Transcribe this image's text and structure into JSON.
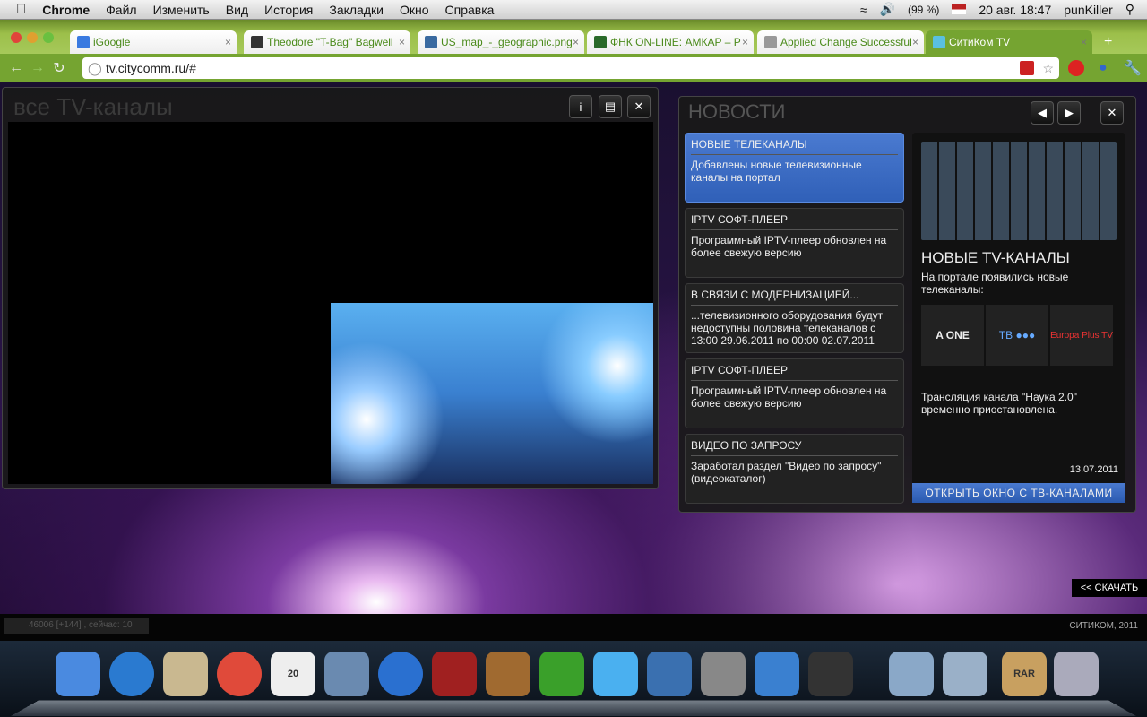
{
  "menubar": {
    "app": "Chrome",
    "items": [
      "Файл",
      "Изменить",
      "Вид",
      "История",
      "Закладки",
      "Окно",
      "Справка"
    ],
    "battery": "(99 %)",
    "datetime": "20 авг.  18:47",
    "user": "punKiller"
  },
  "tabs": [
    {
      "title": "iGoogle",
      "color": "#3a7ae0"
    },
    {
      "title": "Theodore \"T-Bag\" Bagwell",
      "color": "#333"
    },
    {
      "title": "US_map_-_geographic.png",
      "color": "#3a6aa0"
    },
    {
      "title": "ФНК ON-LINE: АМКАР – Р",
      "color": "#2a6a2a"
    },
    {
      "title": "Applied Change Successful",
      "color": "#999"
    },
    {
      "title": "СитиКом TV",
      "color": "#5ac0e0"
    }
  ],
  "url": "tv.citycomm.ru/#",
  "left_panel": {
    "title": "все TV-каналы"
  },
  "news_panel": {
    "title": "НОВОСТИ",
    "items": [
      {
        "title": "НОВЫЕ ТЕЛЕКАНАЛЫ",
        "text": "Добавлены новые телевизионные каналы на портал"
      },
      {
        "title": "IPTV СОФТ-ПЛЕЕР",
        "text": "Программный IPTV-плеер обновлен на более свежую версию"
      },
      {
        "title": "В СВЯЗИ С МОДЕРНИЗАЦИЕЙ...",
        "text": "...телевизионного оборудования будут недоступны половина телеканалов с 13:00 29.06.2011 по 00:00 02.07.2011"
      },
      {
        "title": "IPTV СОФТ-ПЛЕЕР",
        "text": "Программный IPTV-плеер обновлен на более свежую версию"
      },
      {
        "title": "ВИДЕО ПО ЗАПРОСУ",
        "text": "Заработал раздел \"Видео по запросу\" (видеокаталог)"
      }
    ],
    "feature": {
      "title": "НОВЫЕ TV-КАНАЛЫ",
      "text": "На портале появились новые телеканалы:",
      "logos": [
        "A ONE",
        "ТВ ●●●",
        "Europa Plus TV"
      ],
      "note": "Трансляция канала \"Наука 2.0\" временно приостановлена.",
      "date": "13.07.2011",
      "button": "ОТКРЫТЬ ОКНО С ТВ-КАНАЛАМИ"
    }
  },
  "download": "<< СКАЧАТЬ",
  "counter": "46006 [+144] , сейчас: 10",
  "copyright": "СИТИКОМ, 2011",
  "dock": [
    {
      "name": "finder",
      "color": "#4a8ae0"
    },
    {
      "name": "app-store",
      "color": "#2a7ad0"
    },
    {
      "name": "mail",
      "color": "#c9b890"
    },
    {
      "name": "chrome",
      "color": "#e04a3a"
    },
    {
      "name": "ical",
      "color": "#eee",
      "label": "20"
    },
    {
      "name": "iphoto",
      "color": "#6a8ab0"
    },
    {
      "name": "itunes",
      "color": "#2a70d0"
    },
    {
      "name": "front-row",
      "color": "#a02020"
    },
    {
      "name": "image-capture",
      "color": "#a06a30"
    },
    {
      "name": "adium",
      "color": "#3aa02a"
    },
    {
      "name": "icloud",
      "color": "#4ab0f0"
    },
    {
      "name": "parallels",
      "color": "#3a70b0"
    },
    {
      "name": "system-preferences",
      "color": "#888"
    },
    {
      "name": "xcode",
      "color": "#3a80d0"
    },
    {
      "name": "dvd-player",
      "color": "#333"
    },
    {
      "name": "applications-folder",
      "color": "#8aa8c8"
    },
    {
      "name": "documents-folder",
      "color": "#9ab0c8"
    },
    {
      "name": "rar",
      "color": "#c8a060",
      "label": "RAR"
    },
    {
      "name": "trash",
      "color": "#aab"
    }
  ]
}
